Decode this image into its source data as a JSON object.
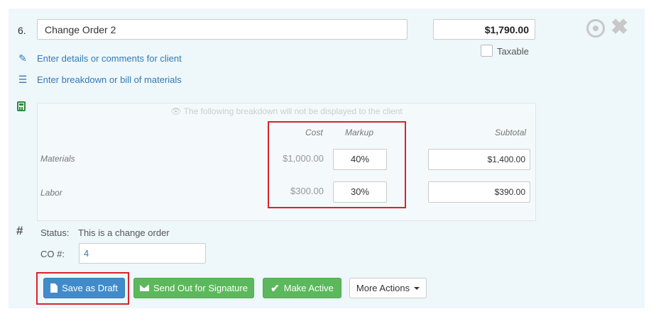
{
  "line_item": {
    "number": "6.",
    "name": "Change Order 2",
    "price": "$1,790.00",
    "taxable_label": "Taxable"
  },
  "links": {
    "details": "Enter details or comments for client",
    "breakdown": "Enter breakdown or bill of materials"
  },
  "breakdown": {
    "notice": "The following breakdown will not be displayed to the client",
    "headers": {
      "cost": "Cost",
      "markup": "Markup",
      "subtotal": "Subtotal"
    },
    "rows": [
      {
        "label": "Materials",
        "cost": "$1,000.00",
        "markup": "40%",
        "subtotal": "$1,400.00"
      },
      {
        "label": "Labor",
        "cost": "$300.00",
        "markup": "30%",
        "subtotal": "$390.00"
      }
    ]
  },
  "status": {
    "label": "Status:",
    "value": "This is a change order",
    "co_label": "CO #:",
    "co_value": "4"
  },
  "actions": {
    "save_draft": "Save as Draft",
    "send_signature": "Send Out for Signature",
    "make_active": "Make Active",
    "more_actions": "More Actions"
  },
  "colors": {
    "panel_bg": "#eef7fa",
    "link": "#337ab7",
    "primary": "#428bca",
    "success": "#5cb85c",
    "highlight": "#d9232d"
  }
}
